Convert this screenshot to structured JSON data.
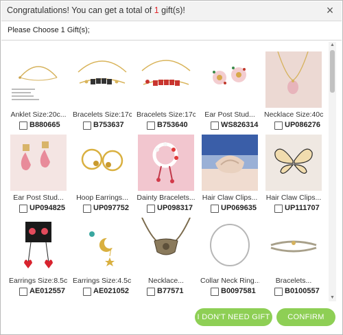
{
  "header": {
    "title_prefix": "Congratulations! You can get a total of ",
    "title_count": "1",
    "title_suffix": " gift(s)!",
    "close_label": "×"
  },
  "subtitle": "Please Choose 1 Gift(s);",
  "products": [
    {
      "name": "Anklet Size:20c...",
      "sku": "B880665",
      "icon": "anklet-chain"
    },
    {
      "name": "Bracelets Size:17c...",
      "sku": "B753637",
      "icon": "baby-bracelet-black"
    },
    {
      "name": "Bracelets Size:17c...",
      "sku": "B753640",
      "icon": "baby-bracelet-red"
    },
    {
      "name": "Ear Post Stud...",
      "sku": "WS826314",
      "icon": "flower-stud-earrings"
    },
    {
      "name": "Necklace Size:40c...",
      "sku": "UP086276",
      "icon": "pendant-necklace"
    },
    {
      "name": "Ear Post Stud...",
      "sku": "UP094825",
      "icon": "pink-drop-earrings"
    },
    {
      "name": "Hoop Earrings...",
      "sku": "UP097752",
      "icon": "rose-hoop-earrings"
    },
    {
      "name": "Dainty Bracelets...",
      "sku": "UP098317",
      "icon": "bead-bracelet"
    },
    {
      "name": "Hair Claw Clips...",
      "sku": "UP069635",
      "icon": "hair-claw-clip"
    },
    {
      "name": "Hair Claw Clips...",
      "sku": "UP111707",
      "icon": "butterfly-claw-clip"
    },
    {
      "name": "Earrings Size:8.5c...",
      "sku": "AE012557",
      "icon": "heart-drop-earrings"
    },
    {
      "name": "Earrings Size:4.5c...",
      "sku": "AE021052",
      "icon": "moon-star-earrings"
    },
    {
      "name": "Necklace...",
      "sku": "B77571",
      "icon": "tribal-necklace"
    },
    {
      "name": "Collar Neck Ring...",
      "sku": "B0097581",
      "icon": "collar-neck-ring"
    },
    {
      "name": "Bracelets...",
      "sku": "B0100557",
      "icon": "cord-bracelet"
    }
  ],
  "buttons": {
    "no_gift": "I DON'T NEED GIFT",
    "confirm": "CONFIRM"
  },
  "colors": {
    "accent_red": "#e0262b",
    "button_green": "#8ecf55"
  }
}
